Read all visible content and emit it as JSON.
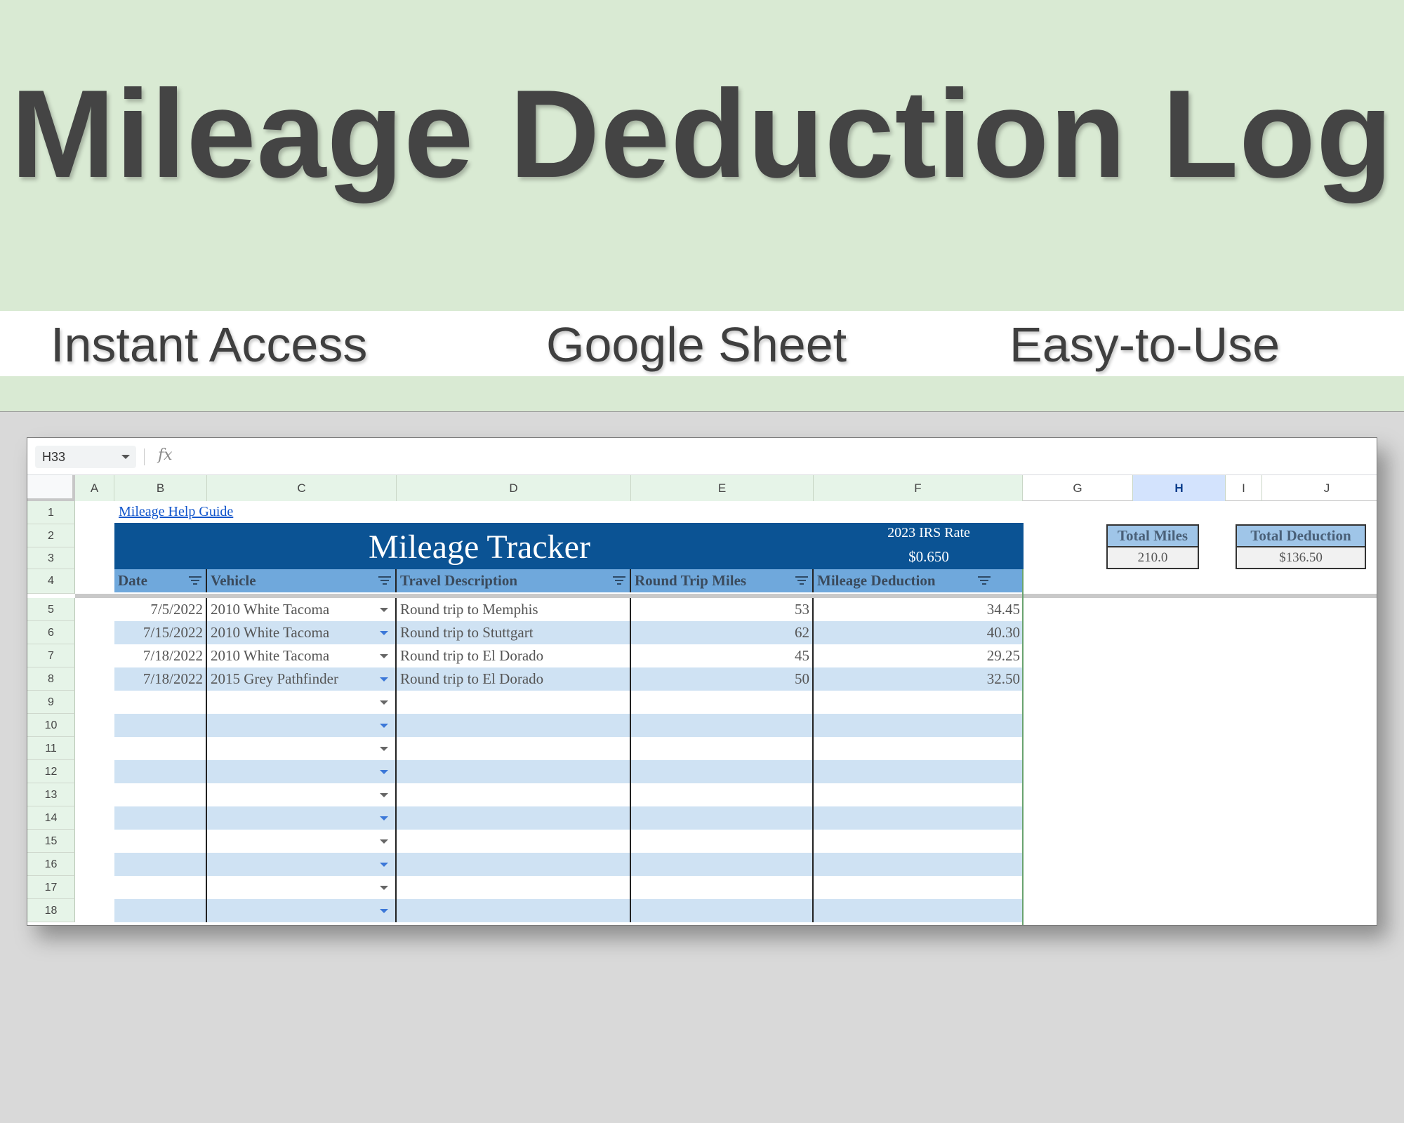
{
  "banner": {
    "title": "Mileage Deduction Log",
    "features": [
      "Instant Access",
      "Google Sheet",
      "Easy-to-Use"
    ]
  },
  "formula_bar": {
    "name_box": "H33",
    "fx_label": "fx"
  },
  "columns": [
    "A",
    "B",
    "C",
    "D",
    "E",
    "F",
    "G",
    "H",
    "I",
    "J"
  ],
  "active_column": "H",
  "row_numbers": [
    "1",
    "2",
    "3",
    "4",
    "5",
    "6",
    "7",
    "8",
    "9",
    "10",
    "11",
    "12",
    "13",
    "14",
    "15",
    "16",
    "17",
    "18"
  ],
  "sheet": {
    "help_link": "Mileage Help Guide",
    "tracker_title": "Mileage Tracker",
    "irs_rate_label": "2023 IRS Rate",
    "irs_rate_value": "$0.650",
    "headers": [
      "Date",
      "Vehicle",
      "Travel Description",
      "Round Trip Miles",
      "Mileage Deduction"
    ],
    "rows": [
      {
        "date": "7/5/2022",
        "vehicle": "2010 White Tacoma",
        "description": "Round trip to Memphis",
        "miles": "53",
        "deduction": "34.45"
      },
      {
        "date": "7/15/2022",
        "vehicle": "2010 White Tacoma",
        "description": "Round trip to Stuttgart",
        "miles": "62",
        "deduction": "40.30"
      },
      {
        "date": "7/18/2022",
        "vehicle": "2010 White Tacoma",
        "description": "Round trip to El Dorado",
        "miles": "45",
        "deduction": "29.25"
      },
      {
        "date": "7/18/2022",
        "vehicle": "2015 Grey Pathfinder",
        "description": "Round trip to El Dorado",
        "miles": "50",
        "deduction": "32.50"
      },
      {
        "date": "",
        "vehicle": "",
        "description": "",
        "miles": "",
        "deduction": ""
      },
      {
        "date": "",
        "vehicle": "",
        "description": "",
        "miles": "",
        "deduction": ""
      },
      {
        "date": "",
        "vehicle": "",
        "description": "",
        "miles": "",
        "deduction": ""
      },
      {
        "date": "",
        "vehicle": "",
        "description": "",
        "miles": "",
        "deduction": ""
      },
      {
        "date": "",
        "vehicle": "",
        "description": "",
        "miles": "",
        "deduction": ""
      },
      {
        "date": "",
        "vehicle": "",
        "description": "",
        "miles": "",
        "deduction": ""
      },
      {
        "date": "",
        "vehicle": "",
        "description": "",
        "miles": "",
        "deduction": ""
      },
      {
        "date": "",
        "vehicle": "",
        "description": "",
        "miles": "",
        "deduction": ""
      },
      {
        "date": "",
        "vehicle": "",
        "description": "",
        "miles": "",
        "deduction": ""
      },
      {
        "date": "",
        "vehicle": "",
        "description": "",
        "miles": "",
        "deduction": ""
      }
    ],
    "summary": {
      "total_miles_label": "Total Miles",
      "total_miles_value": "210.0",
      "total_deduction_label": "Total Deduction",
      "total_deduction_value": "$136.50"
    }
  },
  "colors": {
    "banner_bg": "#d9ead3",
    "title_bar": "#0b5394",
    "header_row": "#6fa8dc",
    "band_row": "#cfe2f3",
    "summary_label_bg": "#9fc5e8",
    "link": "#1155cc"
  }
}
